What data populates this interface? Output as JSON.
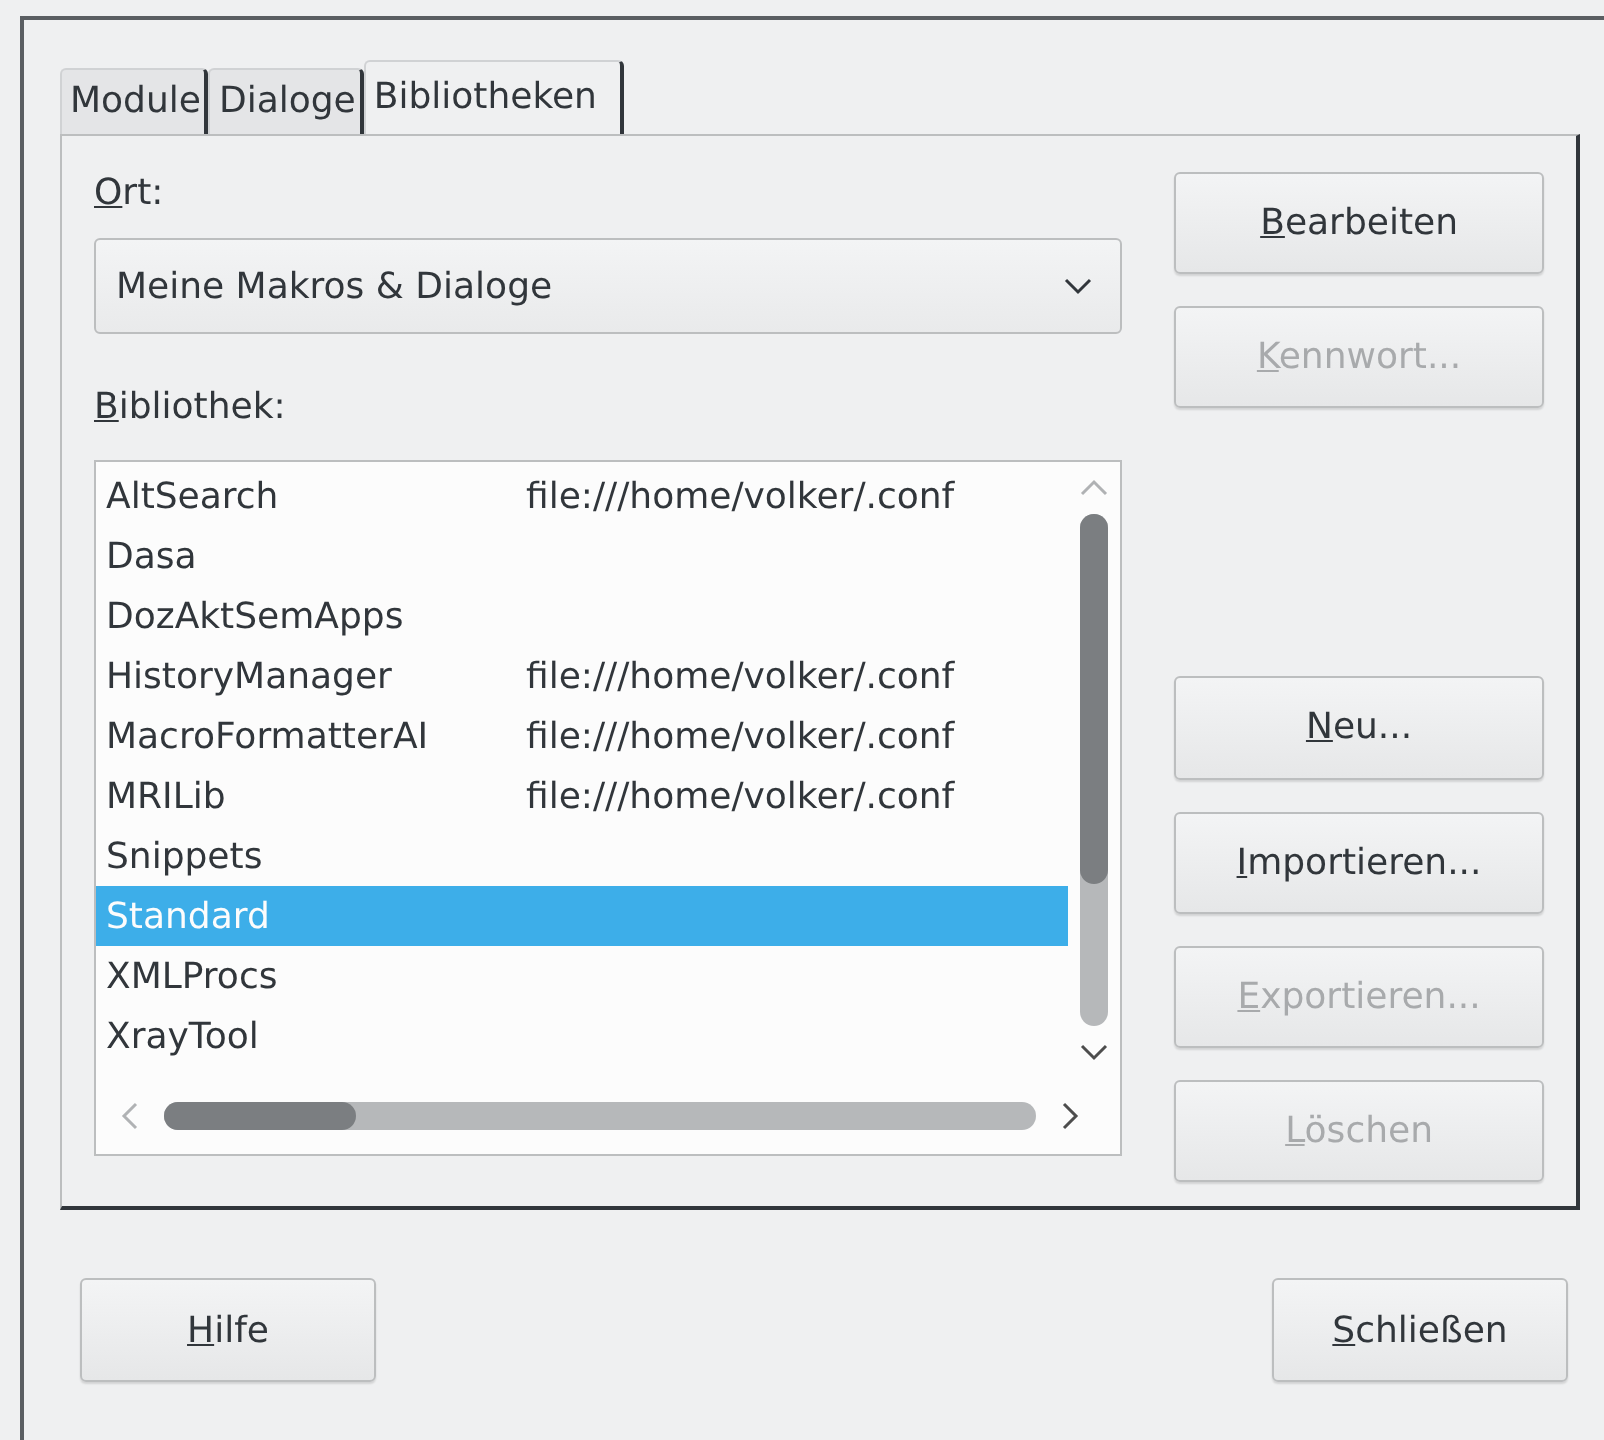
{
  "tabs": [
    {
      "label": "Module",
      "selected": false
    },
    {
      "label": "Dialoge",
      "selected": false
    },
    {
      "label": "Bibliotheken",
      "selected": true
    }
  ],
  "location": {
    "label": "Ort:",
    "value": "Meine Makros & Dialoge"
  },
  "library": {
    "label": "Bibliothek:",
    "rows": [
      {
        "name": "AltSearch",
        "path": "file:///home/volker/.conf",
        "selected": false
      },
      {
        "name": "Dasa",
        "selected": false
      },
      {
        "name": "DozAktSemApps",
        "selected": false
      },
      {
        "name": "HistoryManager",
        "path": "file:///home/volker/.conf",
        "selected": false
      },
      {
        "name": "MacroFormatterAI",
        "path": "file:///home/volker/.conf",
        "selected": false
      },
      {
        "name": "MRILib",
        "path": "file:///home/volker/.conf",
        "selected": false
      },
      {
        "name": "Snippets",
        "selected": false
      },
      {
        "name": "Standard",
        "selected": true
      },
      {
        "name": "XMLProcs",
        "selected": false
      },
      {
        "name": "XrayTool",
        "selected": false
      }
    ]
  },
  "side_buttons": [
    {
      "label": "Bearbeiten",
      "disabled": false,
      "gap_before": false
    },
    {
      "label": "Kennwort...",
      "disabled": true,
      "gap_before": false
    },
    {
      "label": "Neu...",
      "disabled": false,
      "gap_before": true
    },
    {
      "label": "Importieren...",
      "disabled": false,
      "gap_before": false
    },
    {
      "label": "Exportieren...",
      "disabled": true,
      "gap_before": false
    },
    {
      "label": "Löschen",
      "disabled": true,
      "gap_before": false
    }
  ],
  "footer_buttons": [
    {
      "label": "Hilfe"
    },
    {
      "label": "Schließen"
    }
  ]
}
